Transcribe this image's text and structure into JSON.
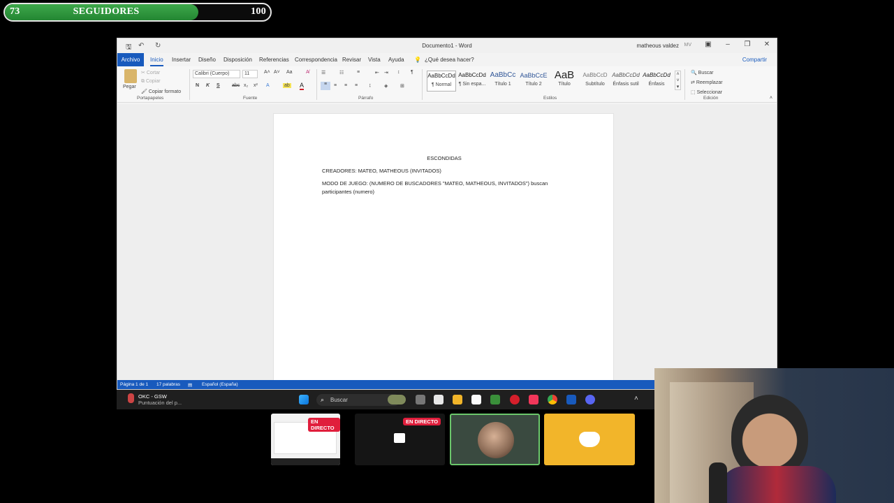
{
  "follower_goal": {
    "current": "73",
    "label": "SEGUIDORES",
    "goal": "100",
    "progress": 0.73
  },
  "word": {
    "title": "Documento1 - Word",
    "user": "matheous valdez",
    "user_initials": "MV",
    "tabs": [
      "Archivo",
      "Inicio",
      "Insertar",
      "Diseño",
      "Disposición",
      "Referencias",
      "Correspondencia",
      "Revisar",
      "Vista",
      "Ayuda"
    ],
    "tell_me": "¿Qué desea hacer?",
    "share": "Compartir",
    "clipboard": {
      "paste": "Pegar",
      "cut": "Cortar",
      "copy": "Copiar",
      "format_painter": "Copiar formato",
      "label": "Portapapeles"
    },
    "font": {
      "name": "Calibri (Cuerpo)",
      "size": "11",
      "bold": "N",
      "italic": "K",
      "underline": "S",
      "label": "Fuente"
    },
    "paragraph": {
      "label": "Párrafo"
    },
    "styles": {
      "label": "Estilos",
      "items": [
        {
          "sample": "AaBbCcDd",
          "name": "¶ Normal"
        },
        {
          "sample": "AaBbCcDd",
          "name": "¶ Sin espa..."
        },
        {
          "sample": "AaBbCc",
          "name": "Título 1"
        },
        {
          "sample": "AaBbCcE",
          "name": "Título 2"
        },
        {
          "sample": "AaB",
          "name": "Título"
        },
        {
          "sample": "AaBbCcD",
          "name": "Subtítulo"
        },
        {
          "sample": "AaBbCcDd",
          "name": "Énfasis sutil"
        },
        {
          "sample": "AaBbCcDd",
          "name": "Énfasis"
        }
      ]
    },
    "editing": {
      "find": "Buscar",
      "replace": "Reemplazar",
      "select": "Seleccionar",
      "label": "Edición"
    },
    "document": {
      "heading": "ESCONDIDAS",
      "line1": "CREADORES: MATEO, MATHEOUS (INVITADOS)",
      "line2a": "MODO DE JUEGO: (NUMERO DE BUSCADORES \"MATEO, MATHEOUS, INVITADOS\") buscan",
      "line2b": "participantes (numero)"
    },
    "status": {
      "page": "Página 1 de 1",
      "words": "17 palabras",
      "lang": "Español (España)"
    }
  },
  "taskbar": {
    "weather_title": "OKC - GSW",
    "weather_sub": "Puntuación del p...",
    "search": "Buscar"
  },
  "previews": {
    "live1": "EN DIRECTO",
    "live2": "EN DIRECTO"
  }
}
